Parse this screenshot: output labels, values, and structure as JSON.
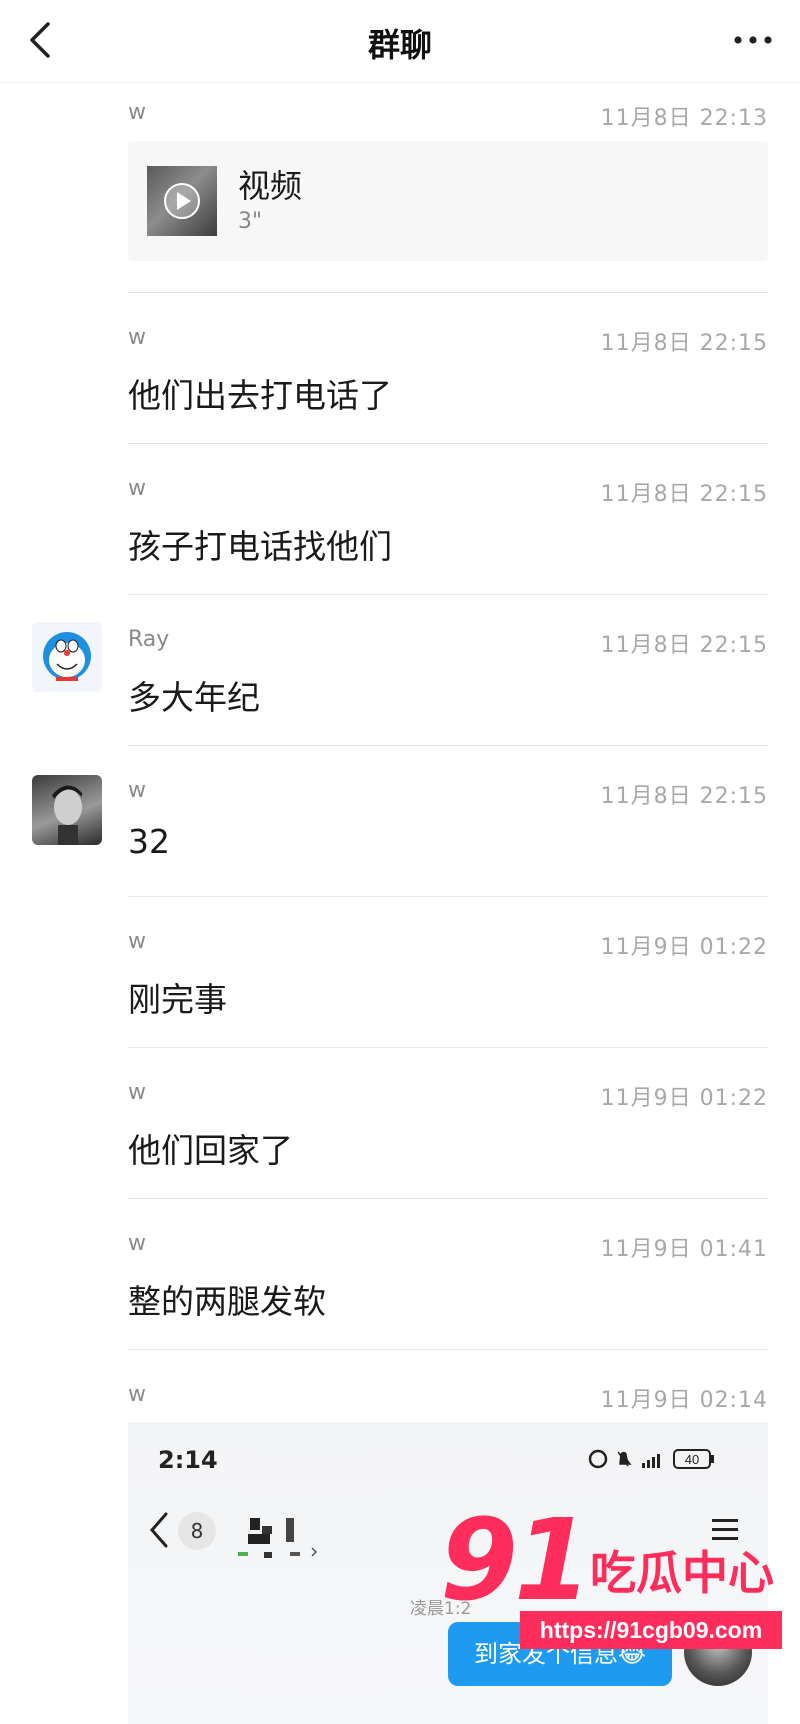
{
  "header": {
    "title": "群聊"
  },
  "messages": [
    {
      "name": "w",
      "time": "11月8日 22:13",
      "type": "video",
      "video": {
        "title": "视频",
        "duration": "3\""
      }
    },
    {
      "name": "w",
      "time": "11月8日 22:15",
      "text": "他们出去打电话了"
    },
    {
      "name": "w",
      "time": "11月8日 22:15",
      "text": "孩子打电话找他们"
    },
    {
      "name": "Ray",
      "time": "11月8日 22:15",
      "text": "多大年纪",
      "avatar": "doraemon-avatar"
    },
    {
      "name": "w",
      "time": "11月8日 22:15",
      "text": "32",
      "avatar": "man-avatar"
    },
    {
      "name": "w",
      "time": "11月9日 01:22",
      "text": "刚完事"
    },
    {
      "name": "w",
      "time": "11月9日 01:22",
      "text": "他们回家了"
    },
    {
      "name": "w",
      "time": "11月9日 01:41",
      "text": "整的两腿发软"
    },
    {
      "name": "w",
      "time": "11月9日 02:14",
      "type": "image"
    }
  ],
  "embedded_screenshot": {
    "status_time": "2:14",
    "battery": "40",
    "unread_badge": "8",
    "timestamp_partial": "凌晨1:2",
    "bubble_text": "到家发个信息😂"
  },
  "watermark": {
    "number": "91",
    "text": "吃瓜中心",
    "url": "https://91cgb09.com"
  },
  "colors": {
    "accent": "#ff2d5c",
    "bubble": "#1e9bf0"
  }
}
